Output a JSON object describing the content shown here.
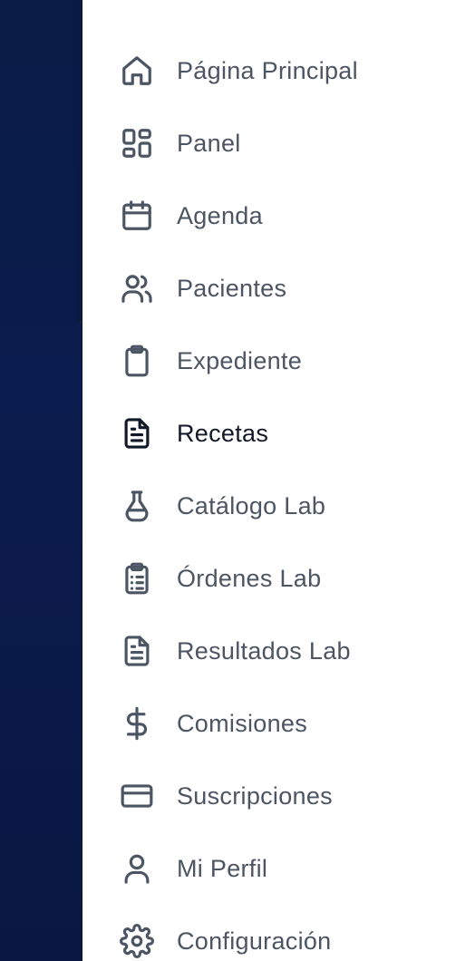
{
  "sidebar": {
    "items": [
      {
        "label": "Página Principal",
        "icon": "home-icon"
      },
      {
        "label": "Panel",
        "icon": "dashboard-icon"
      },
      {
        "label": "Agenda",
        "icon": "calendar-icon"
      },
      {
        "label": "Pacientes",
        "icon": "users-icon"
      },
      {
        "label": "Expediente",
        "icon": "clipboard-icon"
      },
      {
        "label": "Recetas",
        "icon": "document-icon",
        "active": true
      },
      {
        "label": "Catálogo Lab",
        "icon": "flask-icon"
      },
      {
        "label": "Órdenes Lab",
        "icon": "clipboard-list-icon"
      },
      {
        "label": "Resultados Lab",
        "icon": "file-text-icon"
      },
      {
        "label": "Comisiones",
        "icon": "dollar-icon"
      },
      {
        "label": "Suscripciones",
        "icon": "credit-card-icon"
      },
      {
        "label": "Mi Perfil",
        "icon": "user-icon"
      },
      {
        "label": "Configuración",
        "icon": "gear-icon"
      }
    ]
  },
  "colors": {
    "text": "#4b5563",
    "active_text": "#111827",
    "backdrop": "#0b1c4e",
    "drawer_bg": "#ffffff",
    "divider": "#e5e7eb"
  }
}
